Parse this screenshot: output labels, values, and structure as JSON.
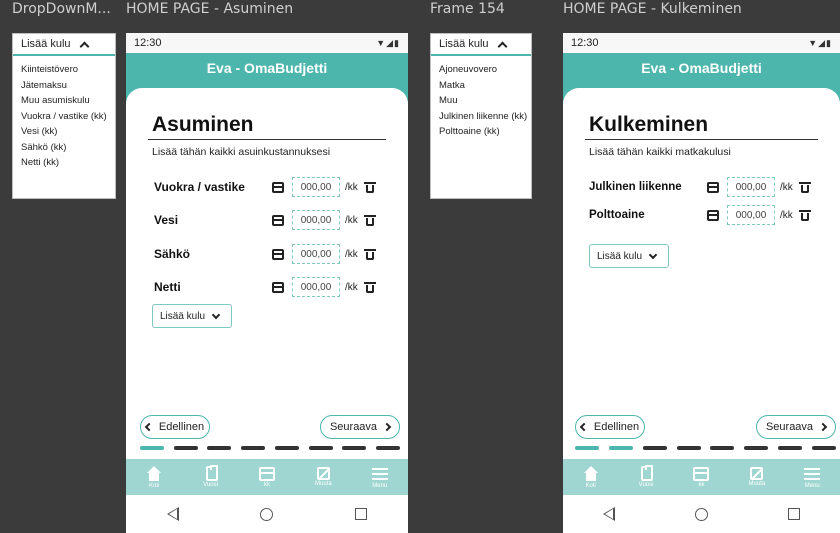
{
  "frames": {
    "dropdown_left": "DropDownM...",
    "home_asuminen": "HOME PAGE - Asuminen",
    "frame154": "Frame 154",
    "home_kulkeminen": "HOME PAGE - Kulkeminen"
  },
  "dropdown_asuminen": {
    "label": "Lisää kulu",
    "items": [
      "Kiinteistövero",
      "Jätemaksu",
      "Muu asumiskulu",
      "Vuokra / vastike (kk)",
      "Vesi (kk)",
      "Sähkö (kk)",
      "Netti (kk)"
    ]
  },
  "dropdown_kulkeminen": {
    "label": "Lisää kulu",
    "items": [
      "Ajoneuvovero",
      "Matka",
      "Muu",
      "Julkinen liikenne (kk)",
      "Polttoaine (kk)"
    ]
  },
  "status": {
    "time": "12:30",
    "icons": "▼◢▮"
  },
  "app_title": "Eva - OmaBudjetti",
  "asuminen": {
    "title": "Asuminen",
    "subtitle": "Lisää tähän kaikki asuinkustannuksesi",
    "rows": [
      {
        "label": "Vuokra / vastike",
        "amount": "000,00",
        "unit": "/kk"
      },
      {
        "label": "Vesi",
        "amount": "000,00",
        "unit": "/kk"
      },
      {
        "label": "Sähkö",
        "amount": "000,00",
        "unit": "/kk"
      },
      {
        "label": "Netti",
        "amount": "000,00",
        "unit": "/kk"
      }
    ],
    "add_label": "Lisää kulu",
    "progress_active": 0
  },
  "kulkeminen": {
    "title": "Kulkeminen",
    "subtitle": "Lisää tähän kaikki matkakulusi",
    "rows": [
      {
        "label": "Julkinen liikenne",
        "amount": "000,00",
        "unit": "/kk"
      },
      {
        "label": "Polttoaine",
        "amount": "000,00",
        "unit": "/kk"
      }
    ],
    "add_label": "Lisää kulu",
    "progress_active": 1
  },
  "nav": {
    "prev": "Edellinen",
    "next": "Seuraava"
  },
  "bottom_nav": [
    "Koti",
    "Vuosi",
    "kk",
    "Muuta",
    "Menu"
  ],
  "progress_segments": 8,
  "colors": {
    "accent": "#4db6ac",
    "accent_light": "#9fd6d1",
    "background": "#3b3b3b"
  }
}
